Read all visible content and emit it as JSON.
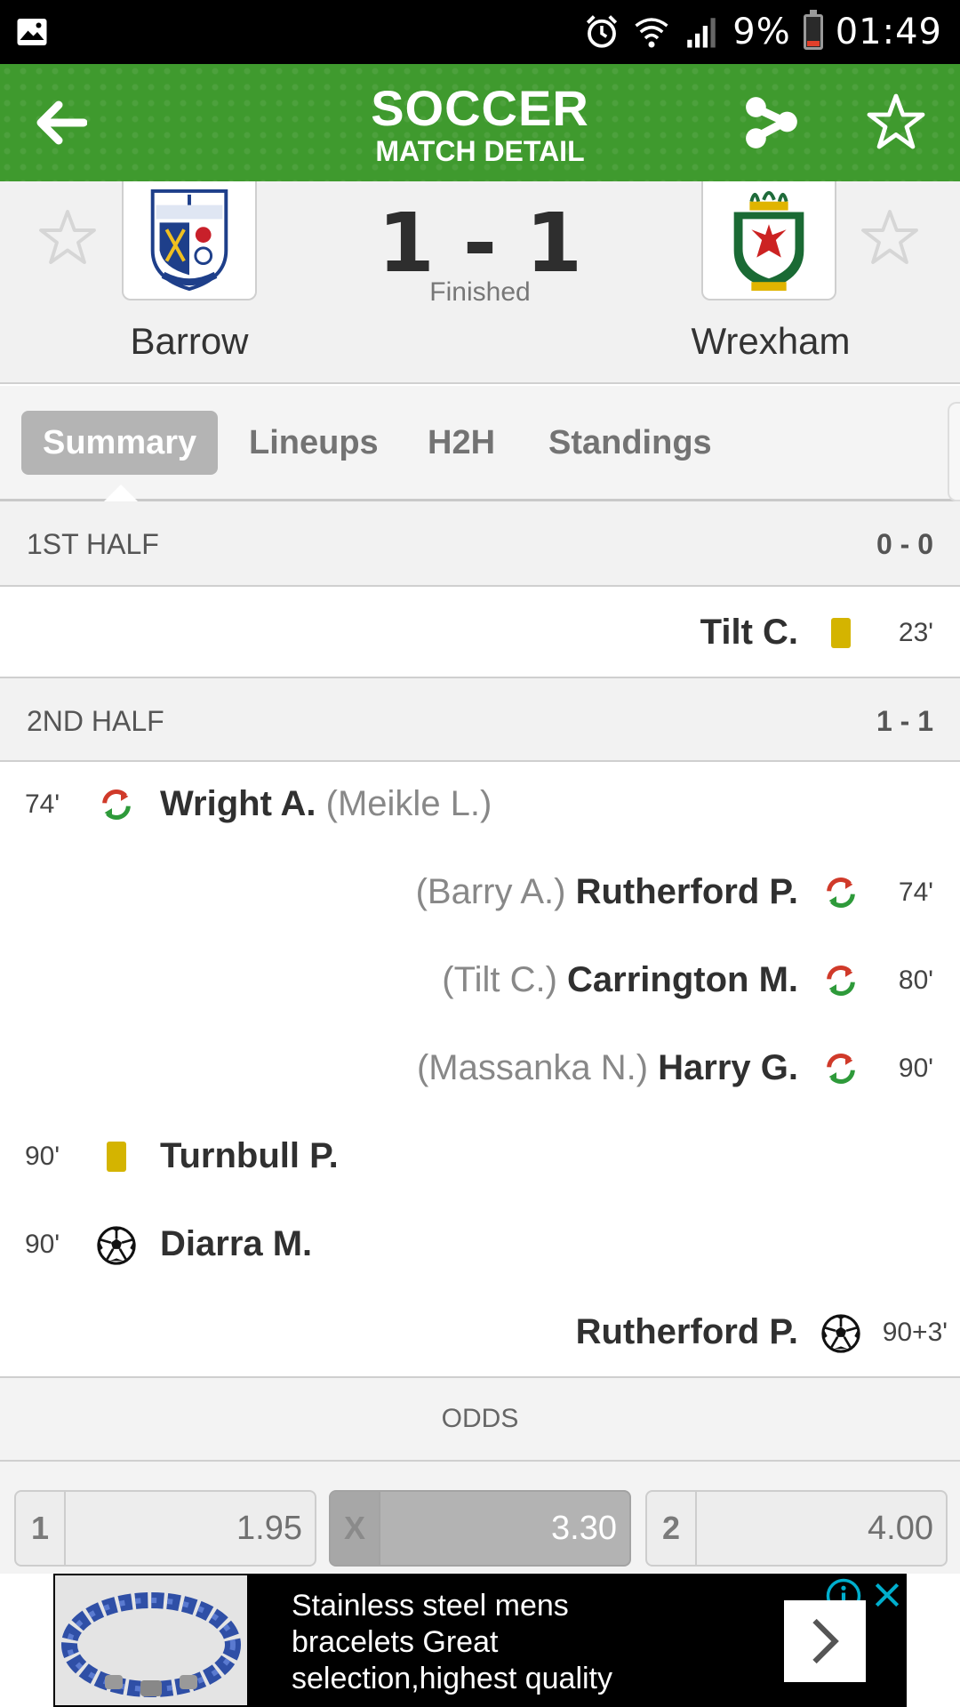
{
  "status_bar": {
    "battery": "9%",
    "time": "01:49"
  },
  "header": {
    "title": "SOCCER",
    "subtitle": "MATCH DETAIL"
  },
  "match": {
    "home": {
      "name": "Barrow"
    },
    "away": {
      "name": "Wrexham"
    },
    "score": "1 - 1",
    "status": "Finished"
  },
  "tabs": [
    {
      "label": "Summary",
      "active": true
    },
    {
      "label": "Lineups",
      "active": false
    },
    {
      "label": "H2H",
      "active": false
    },
    {
      "label": "Standings",
      "active": false
    }
  ],
  "periods": [
    {
      "name": "1ST HALF",
      "score": "0 - 0"
    },
    {
      "name": "2ND HALF",
      "score": "1 - 1"
    }
  ],
  "events": [
    {
      "side": "away",
      "minute": "23'",
      "type": "yellow-card",
      "player": "Tilt C.",
      "sub": ""
    },
    {
      "side": "home",
      "minute": "74'",
      "type": "substitution",
      "player": "Wright A.",
      "sub": "(Meikle L.)"
    },
    {
      "side": "away",
      "minute": "74'",
      "type": "substitution",
      "player": "Rutherford P.",
      "sub": "(Barry A.)"
    },
    {
      "side": "away",
      "minute": "80'",
      "type": "substitution",
      "player": "Carrington M.",
      "sub": "(Tilt C.)"
    },
    {
      "side": "away",
      "minute": "90'",
      "type": "substitution",
      "player": "Harry G.",
      "sub": "(Massanka N.)"
    },
    {
      "side": "home",
      "minute": "90'",
      "type": "yellow-card",
      "player": "Turnbull P.",
      "sub": ""
    },
    {
      "side": "home",
      "minute": "90'",
      "type": "goal",
      "player": "Diarra M.",
      "sub": ""
    },
    {
      "side": "away",
      "minute": "90+3'",
      "type": "goal",
      "player": "Rutherford P.",
      "sub": ""
    }
  ],
  "odds": {
    "title": "ODDS",
    "items": [
      {
        "label": "1",
        "value": "1.95",
        "selected": false
      },
      {
        "label": "X",
        "value": "3.30",
        "selected": true
      },
      {
        "label": "2",
        "value": "4.00",
        "selected": false
      }
    ]
  },
  "ad": {
    "text": "Stainless steel mens bracelets Great selection,highest quality"
  },
  "colors": {
    "brand_green": "#3f9a2e",
    "card_yellow": "#d4b400",
    "sub_green": "#2e9a3a",
    "sub_red": "#d03a2a"
  },
  "icons": [
    "gallery-icon",
    "alarm-icon",
    "wifi-icon",
    "signal-icon",
    "battery-icon",
    "back-arrow-icon",
    "share-icon",
    "star-icon",
    "substitution-icon",
    "yellow-card-icon",
    "ball-icon",
    "info-icon",
    "close-icon",
    "chevron-right-icon"
  ]
}
